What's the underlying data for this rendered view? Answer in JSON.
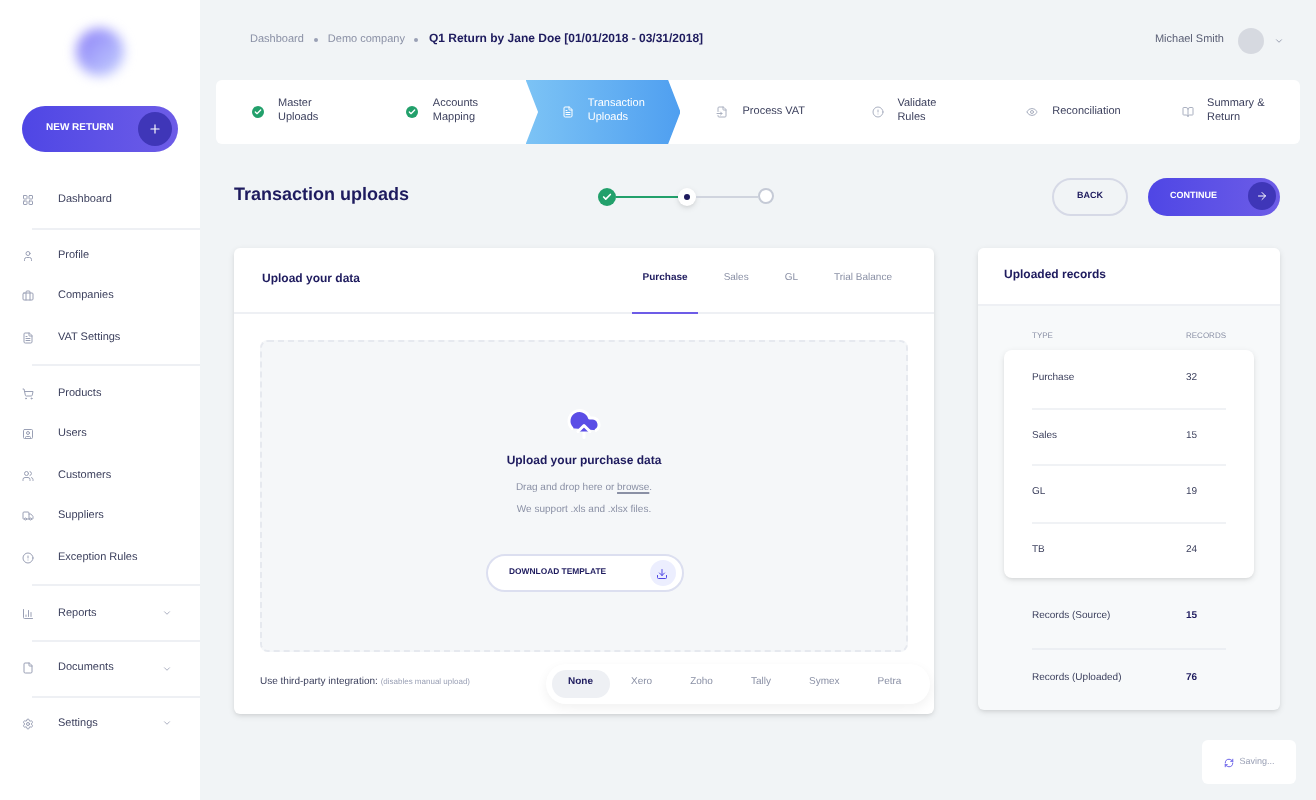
{
  "sidebar": {
    "new_button": "NEW RETURN",
    "sections": [
      {
        "items": [
          {
            "label": "Dashboard",
            "kind": "link"
          }
        ]
      },
      {
        "items": [
          {
            "label": "Profile",
            "kind": "link"
          },
          {
            "label": "Companies",
            "kind": "link"
          },
          {
            "label": "VAT Settings",
            "kind": "link"
          }
        ]
      },
      {
        "items": [
          {
            "label": "Products",
            "kind": "link"
          },
          {
            "label": "Users",
            "kind": "link"
          },
          {
            "label": "Customers",
            "kind": "link"
          },
          {
            "label": "Suppliers",
            "kind": "link"
          },
          {
            "label": "Exception Rules",
            "kind": "link"
          }
        ]
      },
      {
        "items": [
          {
            "label": "Reports",
            "kind": "menu"
          }
        ]
      },
      {
        "items": [
          {
            "label": "Documents",
            "kind": "menu"
          }
        ]
      },
      {
        "items": [
          {
            "label": "Settings",
            "kind": "menu"
          }
        ]
      }
    ]
  },
  "breadcrumb": [
    {
      "label": "Dashboard",
      "selected": false
    },
    {
      "label": "Demo company",
      "selected": false
    },
    {
      "label": "Q1 Return by Jane Doe [01/01/2018 - 03/31/2018]",
      "selected": true
    }
  ],
  "user": {
    "name": "Michael Smith"
  },
  "steps": [
    {
      "label": "Master Uploads",
      "completed": true,
      "selected": false
    },
    {
      "label": "Accounts Mapping",
      "completed": true,
      "selected": false
    },
    {
      "label": "Transaction Uploads",
      "completed": false,
      "selected": true
    },
    {
      "label": "Process VAT",
      "completed": false,
      "selected": false
    },
    {
      "label": "Validate Rules",
      "completed": false,
      "selected": false
    },
    {
      "label": "Reconciliation",
      "completed": false,
      "selected": false
    },
    {
      "label": "Summary & Return",
      "completed": false,
      "selected": false
    }
  ],
  "page_title": "Transaction uploads",
  "progress_dots": [
    {
      "completed": true,
      "selected": false
    },
    {
      "completed": false,
      "selected": true
    },
    {
      "completed": false,
      "selected": false
    }
  ],
  "buttons": {
    "back": "BACK",
    "continue": "CONTINUE"
  },
  "upload_card": {
    "title": "Upload your data",
    "tabs": [
      {
        "label": "Purchase",
        "selected": true
      },
      {
        "label": "Sales",
        "selected": false
      },
      {
        "label": "GL",
        "selected": false
      },
      {
        "label": "Trial Balance",
        "selected": false
      }
    ],
    "drop_title": "Upload your purchase data",
    "drop_text": "Drag and drop here or",
    "browse_link": "browse",
    "drop_text_end": ".",
    "drop_text_2": "We support .xls and .xlsx files.",
    "template_button": "DOWNLOAD TEMPLATE",
    "integration_label": "Use third-party integration:",
    "integration_note": "(disables manual upload)",
    "integrations": [
      {
        "label": "None",
        "selected": true
      },
      {
        "label": "Xero",
        "selected": false
      },
      {
        "label": "Zoho",
        "selected": false
      },
      {
        "label": "Tally",
        "selected": false
      },
      {
        "label": "Symex",
        "selected": false
      },
      {
        "label": "Petra",
        "selected": false
      }
    ]
  },
  "records_card": {
    "title": "Uploaded records",
    "columns": [
      "TYPE",
      "RECORDS"
    ],
    "rows": [
      {
        "type": "Purchase",
        "records": "32"
      },
      {
        "type": "Sales",
        "records": "15"
      },
      {
        "type": "GL",
        "records": "19"
      },
      {
        "type": "TB",
        "records": "24"
      }
    ],
    "totals": [
      {
        "type": "Records (Source)",
        "records": "15"
      },
      {
        "type": "Records (Uploaded)",
        "records": "76"
      }
    ]
  },
  "status": "Saving..."
}
